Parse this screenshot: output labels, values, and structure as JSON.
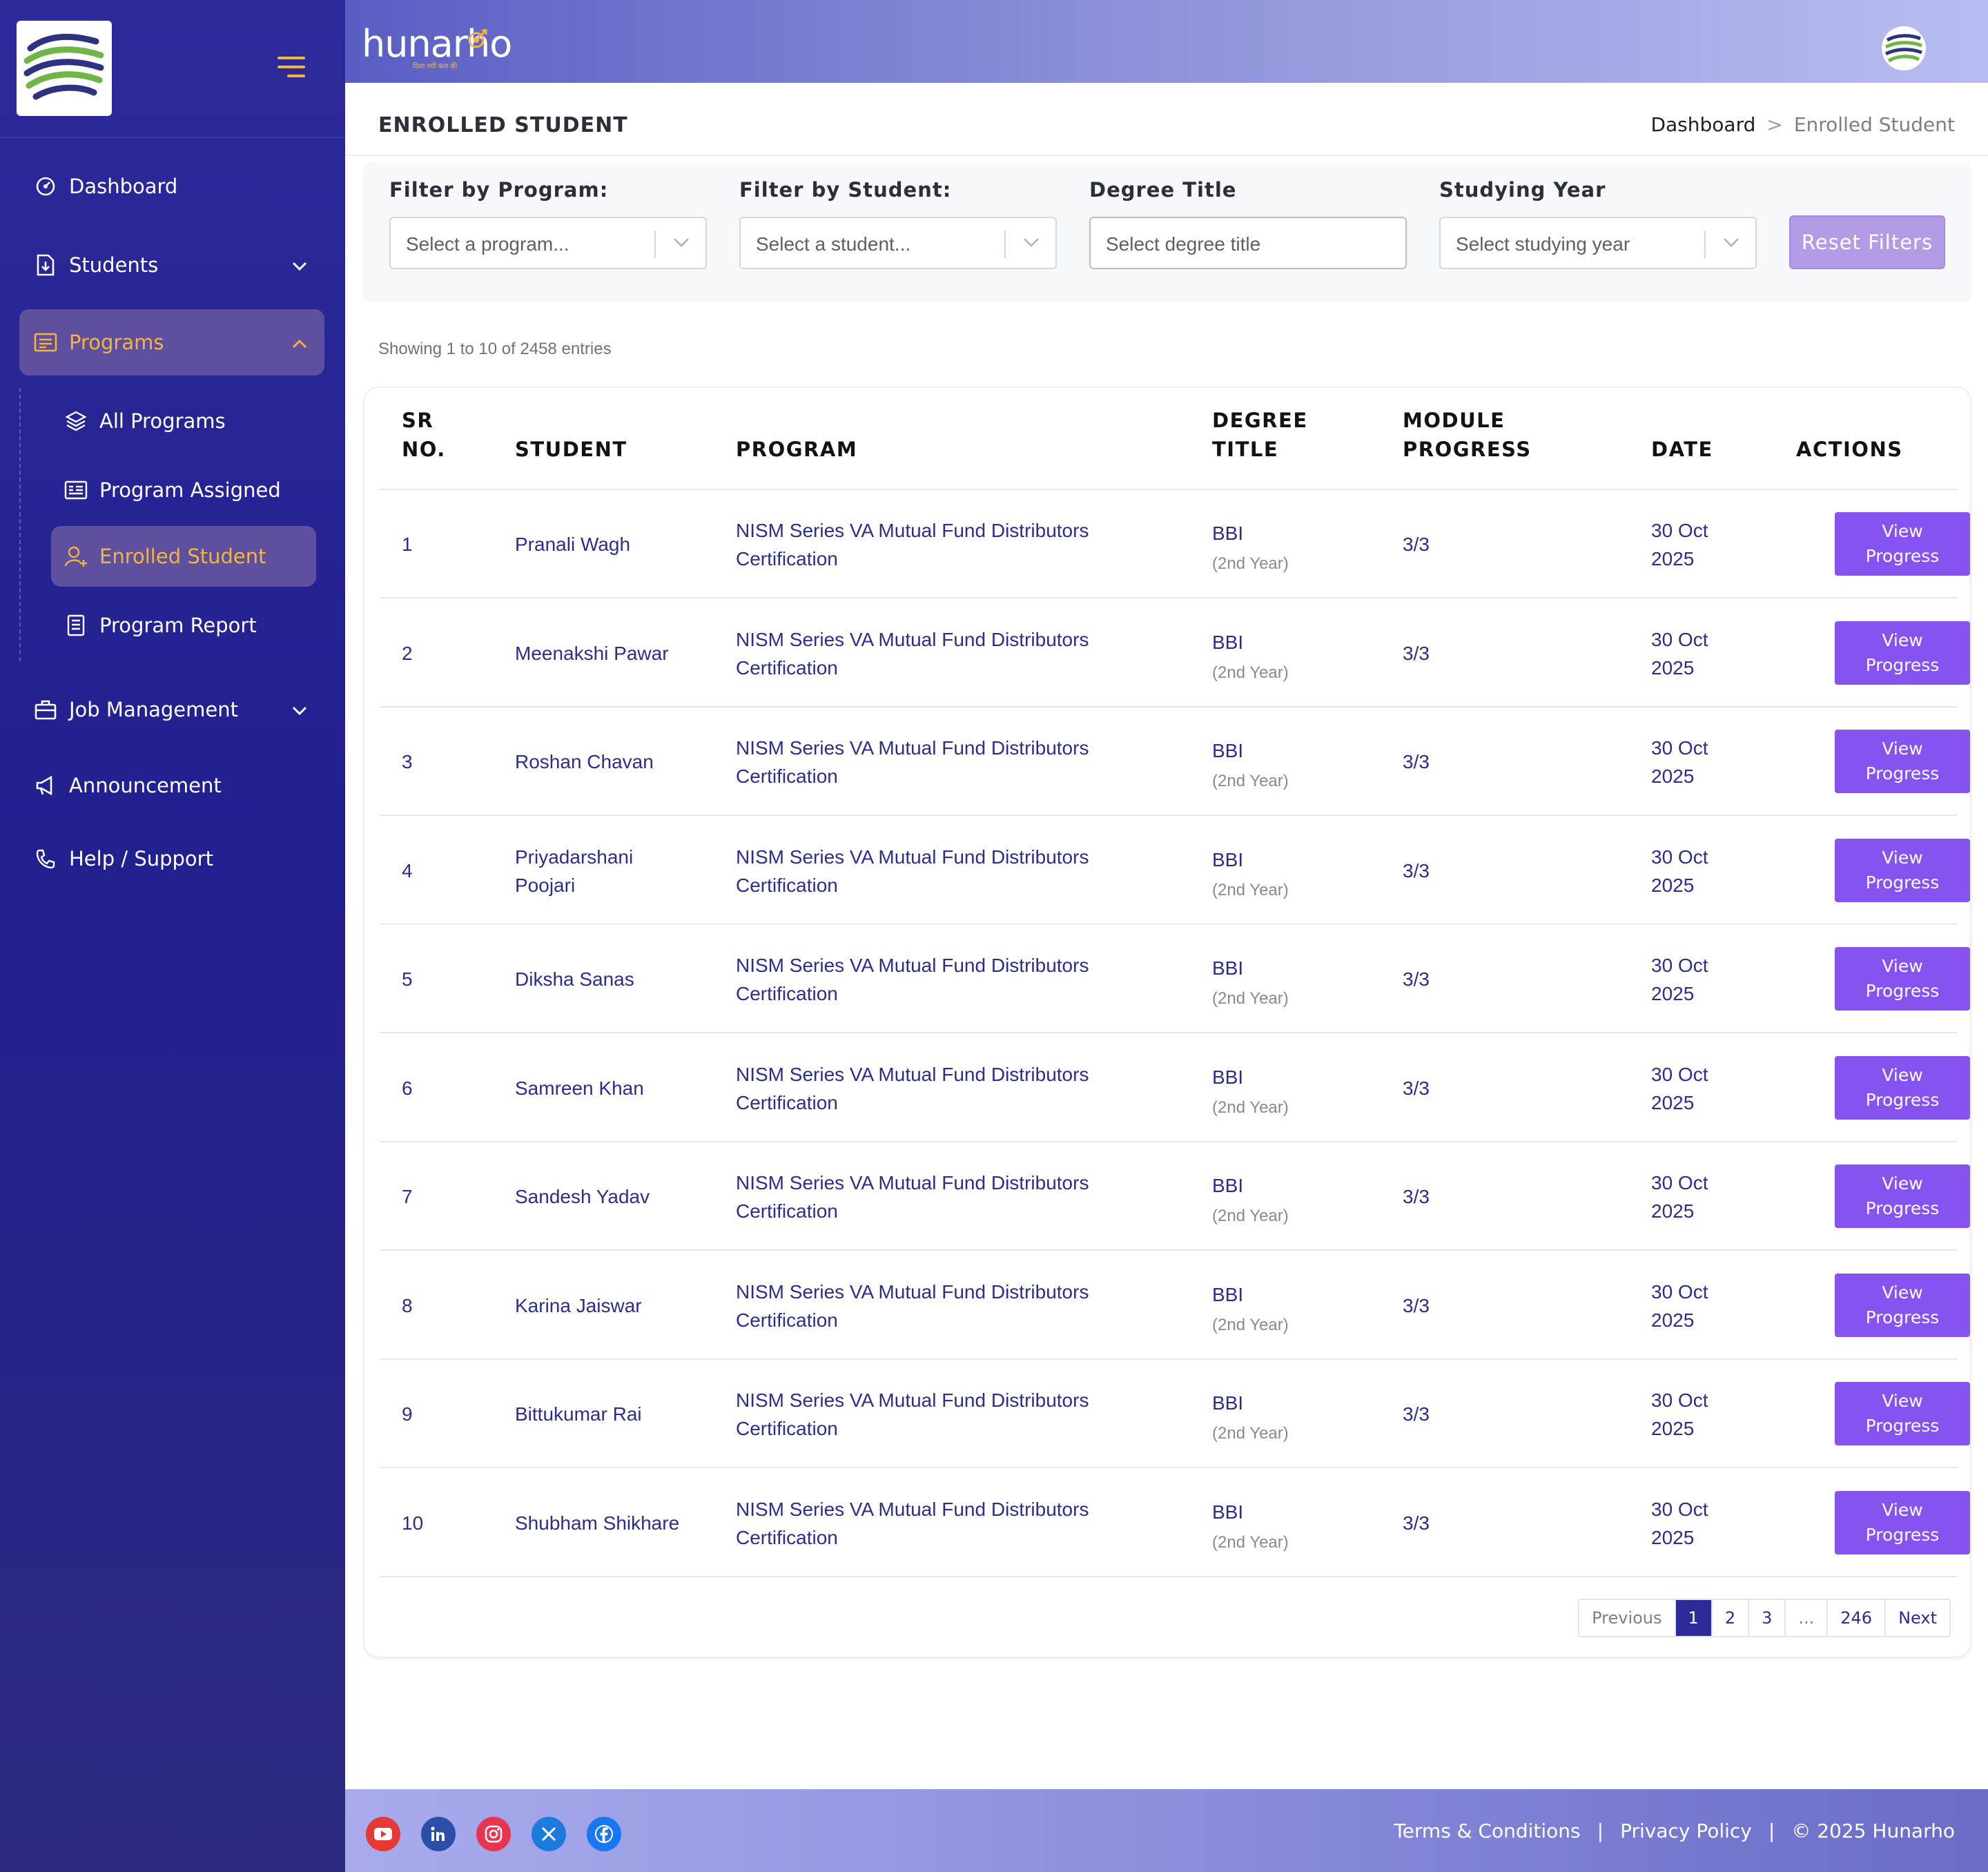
{
  "brand": {
    "name": "hunarho",
    "tagline": "दिशा नयी कल की"
  },
  "sidebar": {
    "items": [
      {
        "label": "Dashboard",
        "icon": "dashboard-icon"
      },
      {
        "label": "Students",
        "icon": "file-download-icon"
      },
      {
        "label": "Programs",
        "icon": "programs-icon",
        "active": true
      },
      {
        "label": "Job Management",
        "icon": "briefcase-icon"
      },
      {
        "label": "Announcement",
        "icon": "megaphone-icon"
      },
      {
        "label": "Help / Support",
        "icon": "phone-icon"
      }
    ],
    "program_sub": [
      {
        "label": "All Programs",
        "icon": "layers-icon"
      },
      {
        "label": "Program Assigned",
        "icon": "id-card-icon"
      },
      {
        "label": "Enrolled Student",
        "icon": "user-add-icon",
        "active": true
      },
      {
        "label": "Program Report",
        "icon": "report-icon"
      }
    ]
  },
  "page": {
    "title": "ENROLLED STUDENT",
    "breadcrumb": [
      "Dashboard",
      ">",
      "Enrolled Student"
    ]
  },
  "filters": {
    "program": {
      "label": "Filter by Program:",
      "placeholder": "Select a program..."
    },
    "student": {
      "label": "Filter by Student:",
      "placeholder": "Select a student..."
    },
    "degree": {
      "label": "Degree Title",
      "placeholder": "Select degree title"
    },
    "year": {
      "label": "Studying Year",
      "placeholder": "Select studying year"
    },
    "reset_label": "Reset Filters"
  },
  "showing_text": "Showing 1 to 10 of 2458 entries",
  "table": {
    "headers": {
      "sr_1": "SR",
      "sr_2": "NO.",
      "student": "STUDENT",
      "program": "PROGRAM",
      "degree_1": "DEGREE",
      "degree_2": "TITLE",
      "module_1": "MODULE",
      "module_2": "PROGRESS",
      "date": "DATE",
      "actions": "ACTIONS"
    },
    "rows": [
      {
        "sr": "1",
        "student": [
          "Pranali Wagh"
        ],
        "program": [
          "NISM Series VA Mutual Fund Distributors",
          "Certification"
        ],
        "degree": "BBI",
        "year": "(2nd Year)",
        "progress": "3/3",
        "date": [
          "30 Oct",
          "2025"
        ],
        "action": [
          "View",
          "Progress"
        ]
      },
      {
        "sr": "2",
        "student": [
          "Meenakshi Pawar"
        ],
        "program": [
          "NISM Series VA Mutual Fund Distributors",
          "Certification"
        ],
        "degree": "BBI",
        "year": "(2nd Year)",
        "progress": "3/3",
        "date": [
          "30 Oct",
          "2025"
        ],
        "action": [
          "View",
          "Progress"
        ]
      },
      {
        "sr": "3",
        "student": [
          "Roshan Chavan"
        ],
        "program": [
          "NISM Series VA Mutual Fund Distributors",
          "Certification"
        ],
        "degree": "BBI",
        "year": "(2nd Year)",
        "progress": "3/3",
        "date": [
          "30 Oct",
          "2025"
        ],
        "action": [
          "View",
          "Progress"
        ]
      },
      {
        "sr": "4",
        "student": [
          "Priyadarshani",
          "Poojari"
        ],
        "program": [
          "NISM Series VA Mutual Fund Distributors",
          "Certification"
        ],
        "degree": "BBI",
        "year": "(2nd Year)",
        "progress": "3/3",
        "date": [
          "30 Oct",
          "2025"
        ],
        "action": [
          "View",
          "Progress"
        ]
      },
      {
        "sr": "5",
        "student": [
          "Diksha Sanas"
        ],
        "program": [
          "NISM Series VA Mutual Fund Distributors",
          "Certification"
        ],
        "degree": "BBI",
        "year": "(2nd Year)",
        "progress": "3/3",
        "date": [
          "30 Oct",
          "2025"
        ],
        "action": [
          "View",
          "Progress"
        ]
      },
      {
        "sr": "6",
        "student": [
          "Samreen Khan"
        ],
        "program": [
          "NISM Series VA Mutual Fund Distributors",
          "Certification"
        ],
        "degree": "BBI",
        "year": "(2nd Year)",
        "progress": "3/3",
        "date": [
          "30 Oct",
          "2025"
        ],
        "action": [
          "View",
          "Progress"
        ]
      },
      {
        "sr": "7",
        "student": [
          "Sandesh Yadav"
        ],
        "program": [
          "NISM Series VA Mutual Fund Distributors",
          "Certification"
        ],
        "degree": "BBI",
        "year": "(2nd Year)",
        "progress": "3/3",
        "date": [
          "30 Oct",
          "2025"
        ],
        "action": [
          "View",
          "Progress"
        ]
      },
      {
        "sr": "8",
        "student": [
          "Karina Jaiswar"
        ],
        "program": [
          "NISM Series VA Mutual Fund Distributors",
          "Certification"
        ],
        "degree": "BBI",
        "year": "(2nd Year)",
        "progress": "3/3",
        "date": [
          "30 Oct",
          "2025"
        ],
        "action": [
          "View",
          "Progress"
        ]
      },
      {
        "sr": "9",
        "student": [
          "Bittukumar Rai"
        ],
        "program": [
          "NISM Series VA Mutual Fund Distributors",
          "Certification"
        ],
        "degree": "BBI",
        "year": "(2nd Year)",
        "progress": "3/3",
        "date": [
          "30 Oct",
          "2025"
        ],
        "action": [
          "View",
          "Progress"
        ]
      },
      {
        "sr": "10",
        "student": [
          "Shubham Shikhare"
        ],
        "program": [
          "NISM Series VA Mutual Fund Distributors",
          "Certification"
        ],
        "degree": "BBI",
        "year": "(2nd Year)",
        "progress": "3/3",
        "date": [
          "30 Oct",
          "2025"
        ],
        "action": [
          "View",
          "Progress"
        ]
      }
    ]
  },
  "pagination": [
    "Previous",
    "1",
    "2",
    "3",
    "...",
    "246",
    "Next"
  ],
  "footer": {
    "social": [
      "youtube-icon",
      "linkedin-icon",
      "instagram-icon",
      "x-icon",
      "facebook-icon"
    ],
    "links": [
      "Terms & Conditions",
      "|",
      "Privacy Policy",
      "|",
      "© 2025 Hunarho"
    ]
  },
  "colors": {
    "sidebar": "#2d2a9a",
    "accent": "#f4b63a",
    "button": "#8652f0",
    "link": "#2b2e8c"
  }
}
